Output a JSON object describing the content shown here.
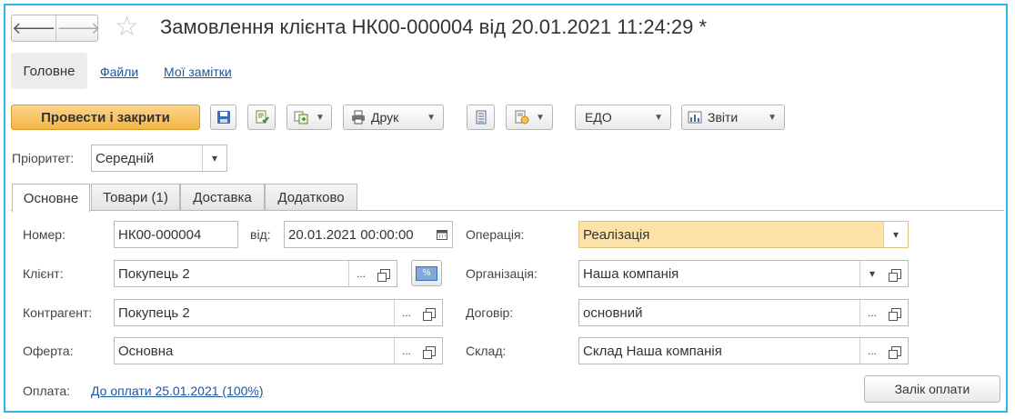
{
  "title": "Замовлення клієнта НК00-000004 від 20.01.2021 11:24:29 *",
  "nav": {
    "back": "🡐",
    "forward": "🡒"
  },
  "sections": {
    "main": "Головне",
    "files": "Файли",
    "notes": "Мої замітки"
  },
  "toolbar": {
    "post_close": "Провести і закрити",
    "print": "Друк",
    "edo": "ЕДО",
    "reports": "Звіти"
  },
  "priority": {
    "label": "Пріоритет:",
    "value": "Середній"
  },
  "tabs": [
    "Основне",
    "Товари (1)",
    "Доставка",
    "Додатково"
  ],
  "form": {
    "number_label": "Номер:",
    "number": "НК00-000004",
    "date_label": "від:",
    "date": "20.01.2021 00:00:00",
    "client_label": "Клієнт:",
    "client": "Покупець 2",
    "counterparty_label": "Контрагент:",
    "counterparty": "Покупець 2",
    "offer_label": "Оферта:",
    "offer": "Основна",
    "operation_label": "Операція:",
    "operation": "Реалізація",
    "org_label": "Організація:",
    "org": "Наша компанія",
    "contract_label": "Договір:",
    "contract": "основний",
    "warehouse_label": "Склад:",
    "warehouse": "Склад Наша компанія",
    "payment_label": "Оплата:",
    "payment_link": "До оплати 25.01.2021 (100%)",
    "offset_button": "Залік оплати",
    "ellipsis": "...",
    "discount_icon_text": "%"
  },
  "colors": {
    "frame": "#2fb4e6",
    "primary": "#f4b647",
    "highlight": "#fde2a8",
    "link": "#1c56a3"
  }
}
